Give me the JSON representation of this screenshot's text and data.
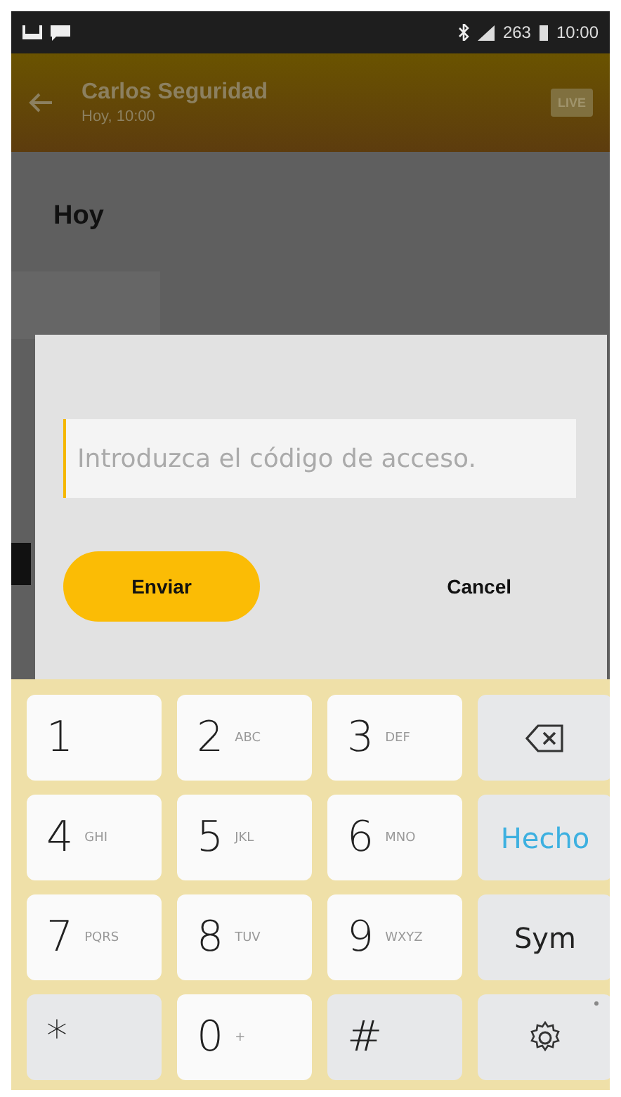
{
  "status_bar": {
    "signal_text": "263",
    "time": "10:00"
  },
  "app_bar": {
    "title": "Carlos Seguridad",
    "subtitle": "Hoy, 10:00",
    "badge": "LIVE"
  },
  "content": {
    "section_title": "Hoy"
  },
  "dialog": {
    "field": {
      "placeholder": "Introduzca el código de acceso."
    },
    "buttons": [
      {
        "label": "Enviar",
        "kind": "primary"
      },
      {
        "label": "Cancel",
        "kind": "text"
      }
    ]
  },
  "keyboard": {
    "keys": [
      {
        "kind": "digit",
        "main": "1"
      },
      {
        "kind": "digit",
        "main": "2",
        "sub": "ABC"
      },
      {
        "kind": "digit",
        "main": "3",
        "sub": "DEF"
      },
      {
        "kind": "backspace"
      },
      {
        "kind": "digit",
        "main": "4",
        "sub": "GHI"
      },
      {
        "kind": "digit",
        "main": "5",
        "sub": "JKL"
      },
      {
        "kind": "digit",
        "main": "6",
        "sub": "MNO"
      },
      {
        "kind": "done",
        "main": "Hecho"
      },
      {
        "kind": "digit",
        "main": "7",
        "sub": "PQRS"
      },
      {
        "kind": "digit",
        "main": "8",
        "sub": "TUV"
      },
      {
        "kind": "digit",
        "main": "9",
        "sub": "WXYZ"
      },
      {
        "kind": "function",
        "main": "Sym"
      },
      {
        "kind": "symbol",
        "main": "*"
      },
      {
        "kind": "digit",
        "main": "0",
        "sub": "+"
      },
      {
        "kind": "symbol",
        "main": "#"
      },
      {
        "kind": "settings"
      }
    ]
  }
}
